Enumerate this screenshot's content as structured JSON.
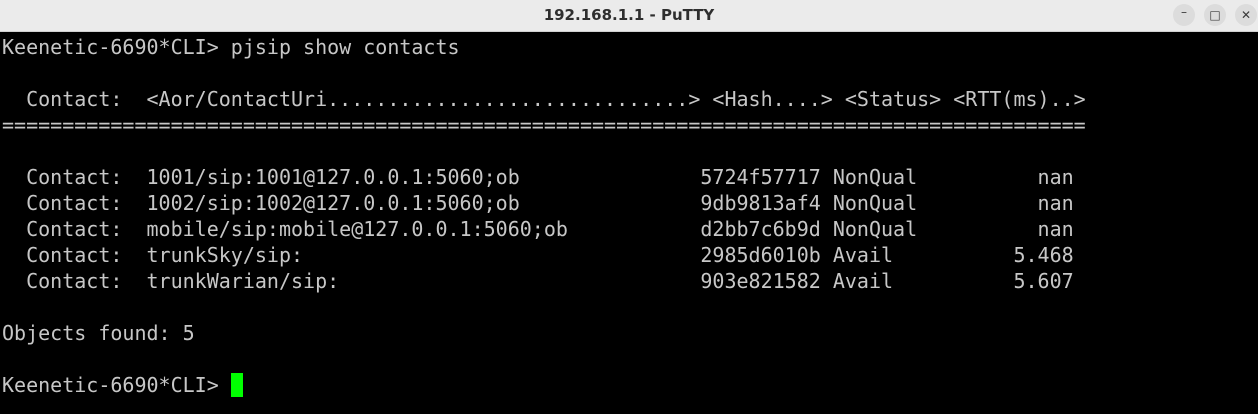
{
  "window": {
    "title": "192.168.1.1 - PuTTY",
    "controls": {
      "minimize": "–",
      "maximize": "□",
      "close": "✕"
    }
  },
  "terminal": {
    "lines": [
      "Keenetic-6690*CLI> pjsip show contacts",
      "",
      "  Contact:  <Aor/ContactUri..............................> <Hash....> <Status> <RTT(ms)..>",
      "==========================================================================================",
      "",
      "  Contact:  1001/sip:1001@127.0.0.1:5060;ob               5724f57717 NonQual          nan",
      "  Contact:  1002/sip:1002@127.0.0.1:5060;ob               9db9813af4 NonQual          nan",
      "  Contact:  mobile/sip:mobile@127.0.0.1:5060;ob           d2bb7c6b9d NonQual          nan",
      "  Contact:  trunkSky/sip:                                 2985d6010b Avail          5.468",
      "  Contact:  trunkWarian/sip:                              903e821582 Avail          5.607",
      "",
      "Objects found: 5",
      "",
      "Keenetic-6690*CLI> "
    ],
    "cursor_color": "#00ff00",
    "text_color": "#c7c7c7",
    "background_color": "#000000"
  }
}
